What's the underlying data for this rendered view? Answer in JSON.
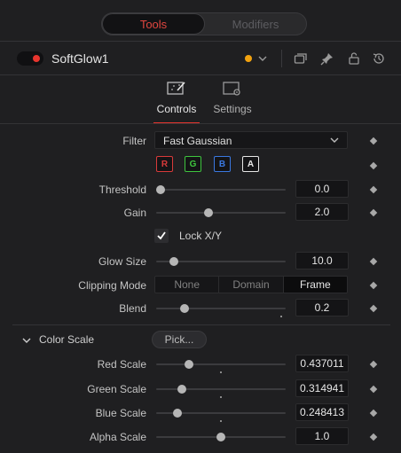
{
  "top_tabs": {
    "tools": "Tools",
    "modifiers": "Modifiers"
  },
  "node": {
    "name": "SoftGlow1",
    "color_dot": "#f2a20f"
  },
  "subtabs": {
    "controls": "Controls",
    "settings": "Settings"
  },
  "controls": {
    "filter": {
      "label": "Filter",
      "value": "Fast Gaussian"
    },
    "channels": [
      "R",
      "G",
      "B",
      "A"
    ],
    "threshold": {
      "label": "Threshold",
      "value": "0.0",
      "fraction": 0.0
    },
    "gain": {
      "label": "Gain",
      "value": "2.0",
      "fraction": 0.4
    },
    "lock": {
      "label": "Lock X/Y",
      "checked": true
    },
    "glow_size": {
      "label": "Glow Size",
      "value": "10.0",
      "fraction": 0.11
    },
    "clipping_mode": {
      "label": "Clipping Mode",
      "options": [
        "None",
        "Domain",
        "Frame"
      ],
      "selected": "Frame"
    },
    "blend": {
      "label": "Blend",
      "value": "0.2",
      "fraction": 0.2
    }
  },
  "color_scale": {
    "title": "Color Scale",
    "pick_label": "Pick...",
    "red": {
      "label": "Red Scale",
      "value": "0.437011",
      "fraction": 0.234
    },
    "green": {
      "label": "Green Scale",
      "value": "0.314941",
      "fraction": 0.177
    },
    "blue": {
      "label": "Blue Scale",
      "value": "0.248413",
      "fraction": 0.143
    },
    "alpha": {
      "label": "Alpha Scale",
      "value": "1.0",
      "fraction": 0.5
    }
  },
  "colors": {
    "accent_red": "#e8352e",
    "r": "#d83a3a",
    "g": "#3ec43e",
    "b": "#3a78e0",
    "a": "#e6e6e6"
  }
}
